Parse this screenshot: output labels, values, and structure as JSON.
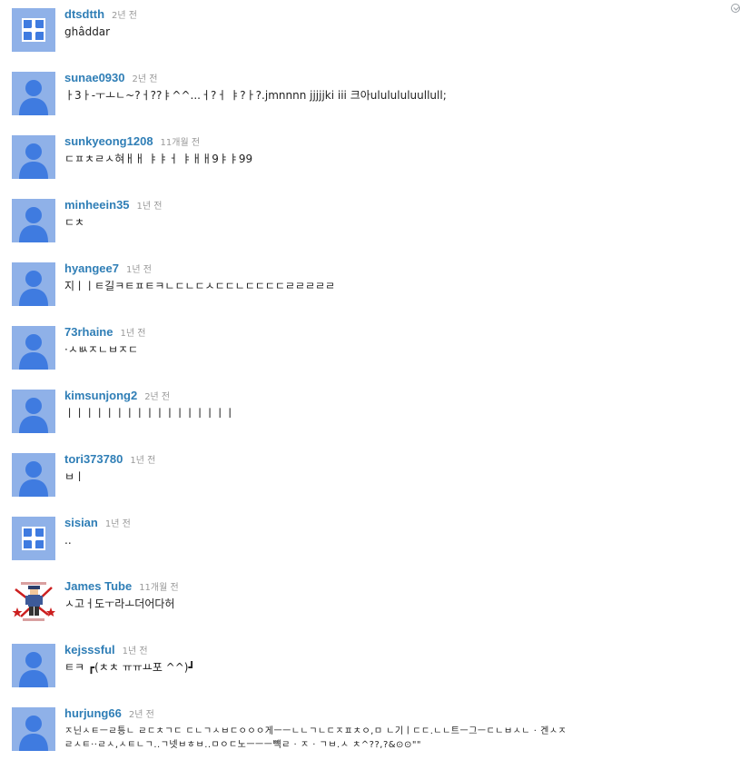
{
  "colors": {
    "author_link": "#2f7eb6",
    "timestamp": "#999999",
    "avatar_bg": "#8fb1e8",
    "avatar_figure": "#3f7be0",
    "gift_icon": "#3f7be0"
  },
  "comments": [
    {
      "author": "dtsdtth",
      "time": "2년 전",
      "text": "ghâddar",
      "avatar": "gift-icon"
    },
    {
      "author": "sunae0930",
      "time": "2년 전",
      "text": "ㅏ3ㅏ-ㅜㅗㄴ~?ㅓ??ㅑ^^...ㅓ?ㅓ ㅑ?ㅏ?.jmnnnn jjjjjki iii 크아ululululuullull;",
      "avatar": "person-silhouette-icon"
    },
    {
      "author": "sunkyeong1208",
      "time": "11개월 전",
      "text": "ㄷㅍㅊㄹㅅ혀ㅐㅐ ㅑㅑㅓ ㅑㅐㅐ9ㅑㅑ99",
      "avatar": "person-silhouette-icon"
    },
    {
      "author": "minheein35",
      "time": "1년 전",
      "text": "ㄷㅊ",
      "avatar": "person-silhouette-icon"
    },
    {
      "author": "hyangee7",
      "time": "1년 전",
      "text": "지ㅣㅣㅌ길ㅋㅌㅍㅌㅋㄴㄷㄴㄷㅅㄷㄷㄴㄷㄷㄷㄷㄹㄹㄹㄹㄹ",
      "avatar": "person-silhouette-icon"
    },
    {
      "author": "73rhaine",
      "time": "1년 전",
      "text": "·ㅅㅄㅈㄴㅂㅈㄷ",
      "avatar": "person-silhouette-icon"
    },
    {
      "author": "kimsunjong2",
      "time": "2년 전",
      "text": "ㅣㅣㅣㅣㅣㅣㅣㅣㅣㅣㅣㅣㅣㅣㅣㅣㅣ",
      "avatar": "person-silhouette-icon"
    },
    {
      "author": "tori373780",
      "time": "1년 전",
      "text": "ㅂㅣ",
      "avatar": "person-silhouette-icon"
    },
    {
      "author": "sisian",
      "time": "1년 전",
      "text": "..",
      "avatar": "gift-icon"
    },
    {
      "author": "James Tube",
      "time": "11개월 전",
      "text": "ㅅ고ㅓ도ㅜ라ㅗ더어다허",
      "avatar": "custom-photo-avatar"
    },
    {
      "author": "kejsssful",
      "time": "1년 전",
      "text": "ㅌㅋ ┏(ㅊㅊ ㅠㅠㅛ포 ^^)┛",
      "avatar": "person-silhouette-icon"
    },
    {
      "author": "hurjung66",
      "time": "2년 전",
      "text": "ㅈ닌ㅅㅌㅡㄹ틍ㄴ ㄹㄷㅊㄱㄷ ㄷㄴㄱㅅㅂㄷㅇㅇㅇ게ㅡㅡㄴㄴㄱㄴㄷㅈㅍㅊㅇ,ㅁ ㄴ기ㅣㄷㄷ.ㄴㄴ트ㅡ그ㅡㄷㄴㅂㅅㄴ · 겐ㅅㅈ\nㄹㅅㅌ··ㄹㅅ,ㅅㅌㄴㄱ..ㄱ넷ㅂㅎㅂ..ㅁㅇㄷ노ㅡㅡㅡ뺵ㄹ · ㅈ · ㄱㅂ.ㅅ ㅊ^??,?&⊙⊙\"\"",
      "avatar": "person-silhouette-icon"
    }
  ]
}
